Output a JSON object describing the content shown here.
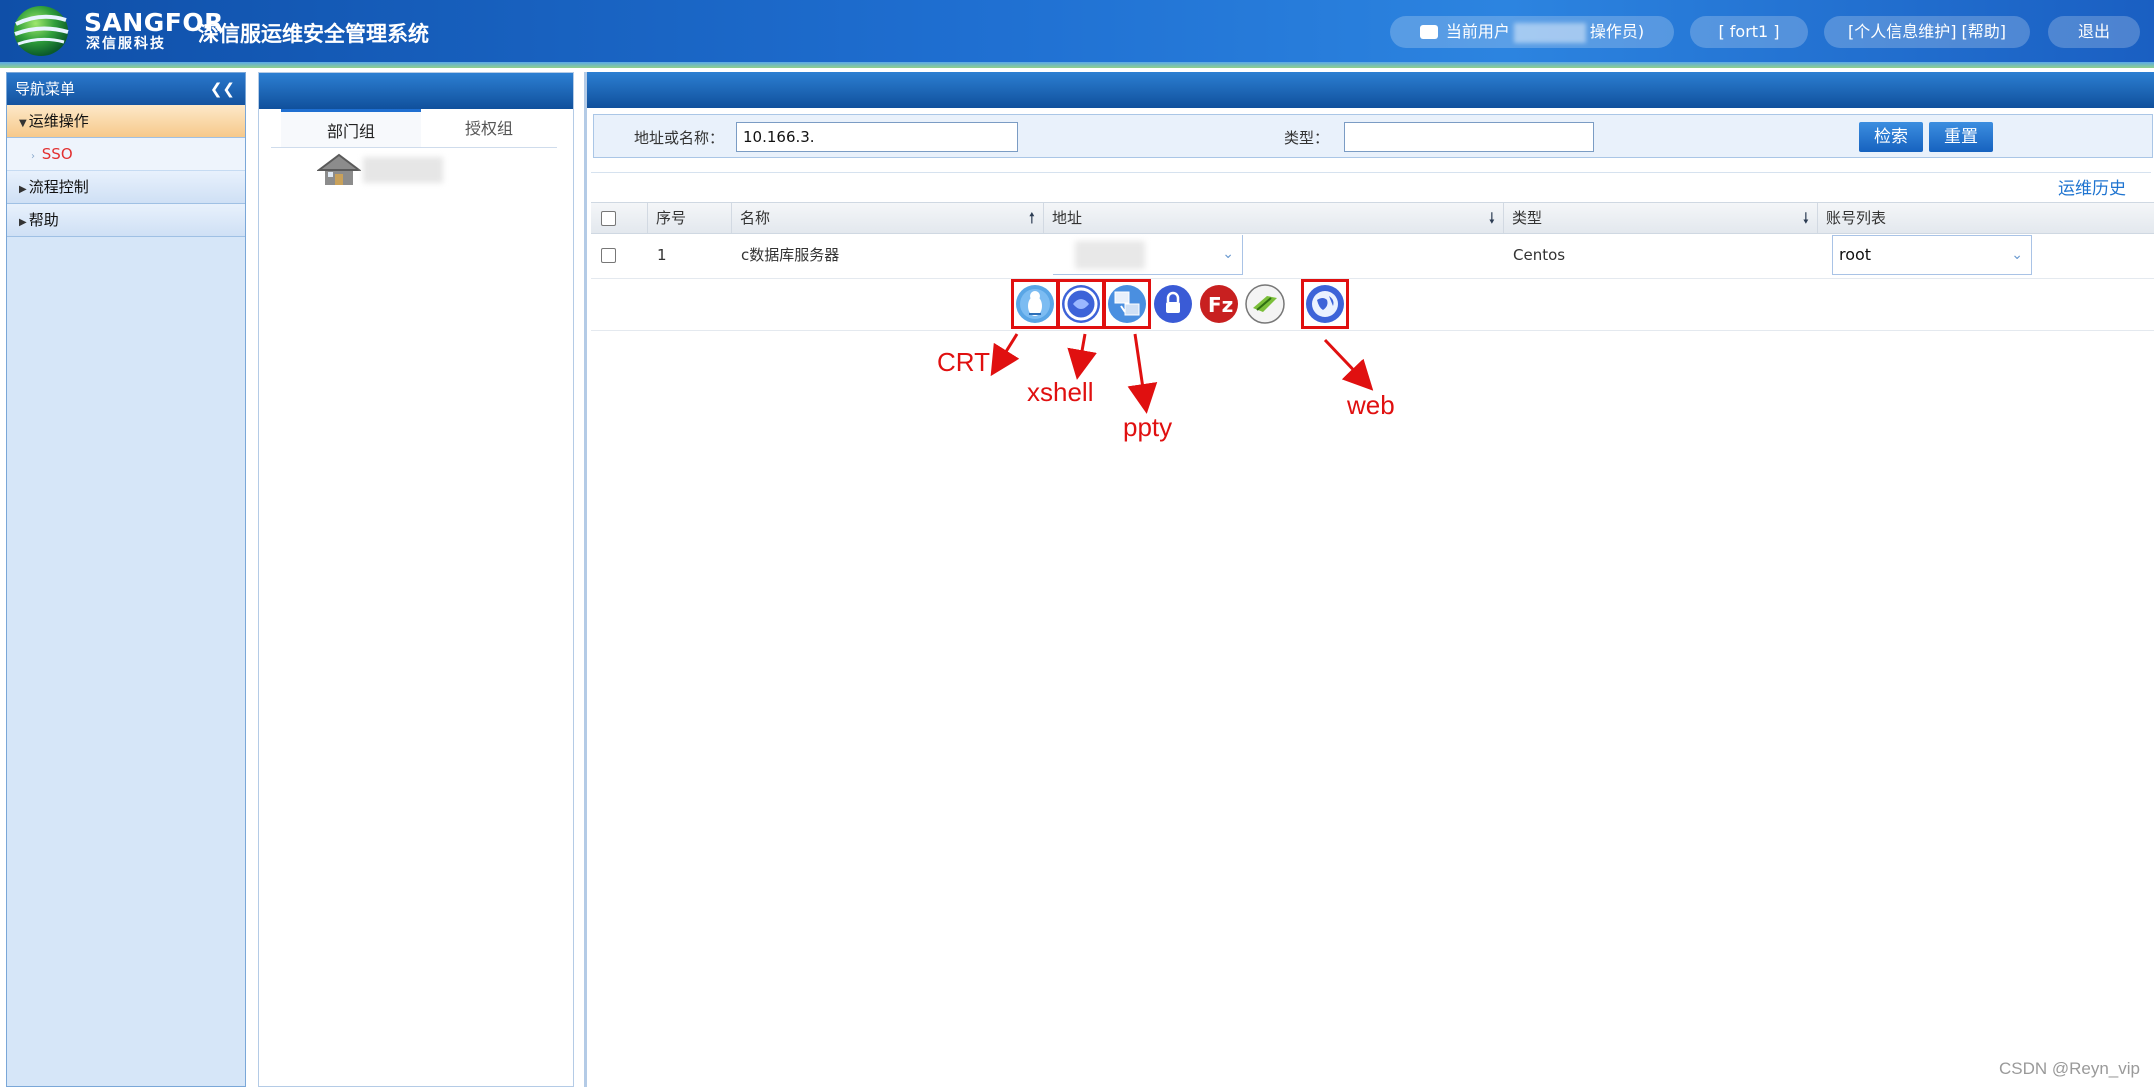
{
  "header": {
    "logo_name": "SANGFOR",
    "logo_sub": "深信服科技",
    "app_title": "深信服运维安全管理系统",
    "current_user_prefix": "当前用户",
    "current_user_suffix": "操作员)",
    "node_label": "[ fort1 ]",
    "profile_help_label": "[个人信息维护] [帮助]",
    "logout_label": "退出"
  },
  "nav": {
    "title": "导航菜单",
    "collapse_glyph": "❮❮",
    "sections": [
      {
        "label": "运维操作",
        "open": true
      },
      {
        "label": "SSO",
        "sub": true
      },
      {
        "label": "流程控制",
        "open": false
      },
      {
        "label": "帮助",
        "open": false
      }
    ]
  },
  "mid": {
    "tabs": [
      "部门组",
      "授权组"
    ]
  },
  "filter": {
    "addr_label": "地址或名称：",
    "addr_value": "10.166.3.",
    "type_label": "类型：",
    "type_value": "",
    "search_label": "检索",
    "reset_label": "重置"
  },
  "history_link": "运维历史",
  "table": {
    "columns": [
      "序号",
      "名称",
      "地址",
      "类型",
      "账号列表"
    ],
    "rows": [
      {
        "index": "1",
        "name": "c数据库服务器",
        "address": "",
        "type": "Centos",
        "account": "root"
      }
    ]
  },
  "tools": [
    {
      "icon": "penguin-icon",
      "highlighted": true
    },
    {
      "icon": "xshell-icon",
      "highlighted": true
    },
    {
      "icon": "putty-icon",
      "highlighted": true
    },
    {
      "icon": "lock-icon",
      "highlighted": false
    },
    {
      "icon": "filezilla-icon",
      "highlighted": false
    },
    {
      "icon": "winscp-icon",
      "highlighted": false
    },
    {
      "icon": "globe-icon",
      "highlighted": true
    }
  ],
  "annotations": {
    "crt": "CRT",
    "xshell": "xshell",
    "ppty": "ppty",
    "web": "web"
  },
  "watermark": "CSDN @Reyn_vip",
  "colors": {
    "header_blue": "#1f6fd1",
    "annotation_red": "#e01010",
    "nav_bg": "#d6e6f8",
    "link_blue": "#1f74d0"
  }
}
